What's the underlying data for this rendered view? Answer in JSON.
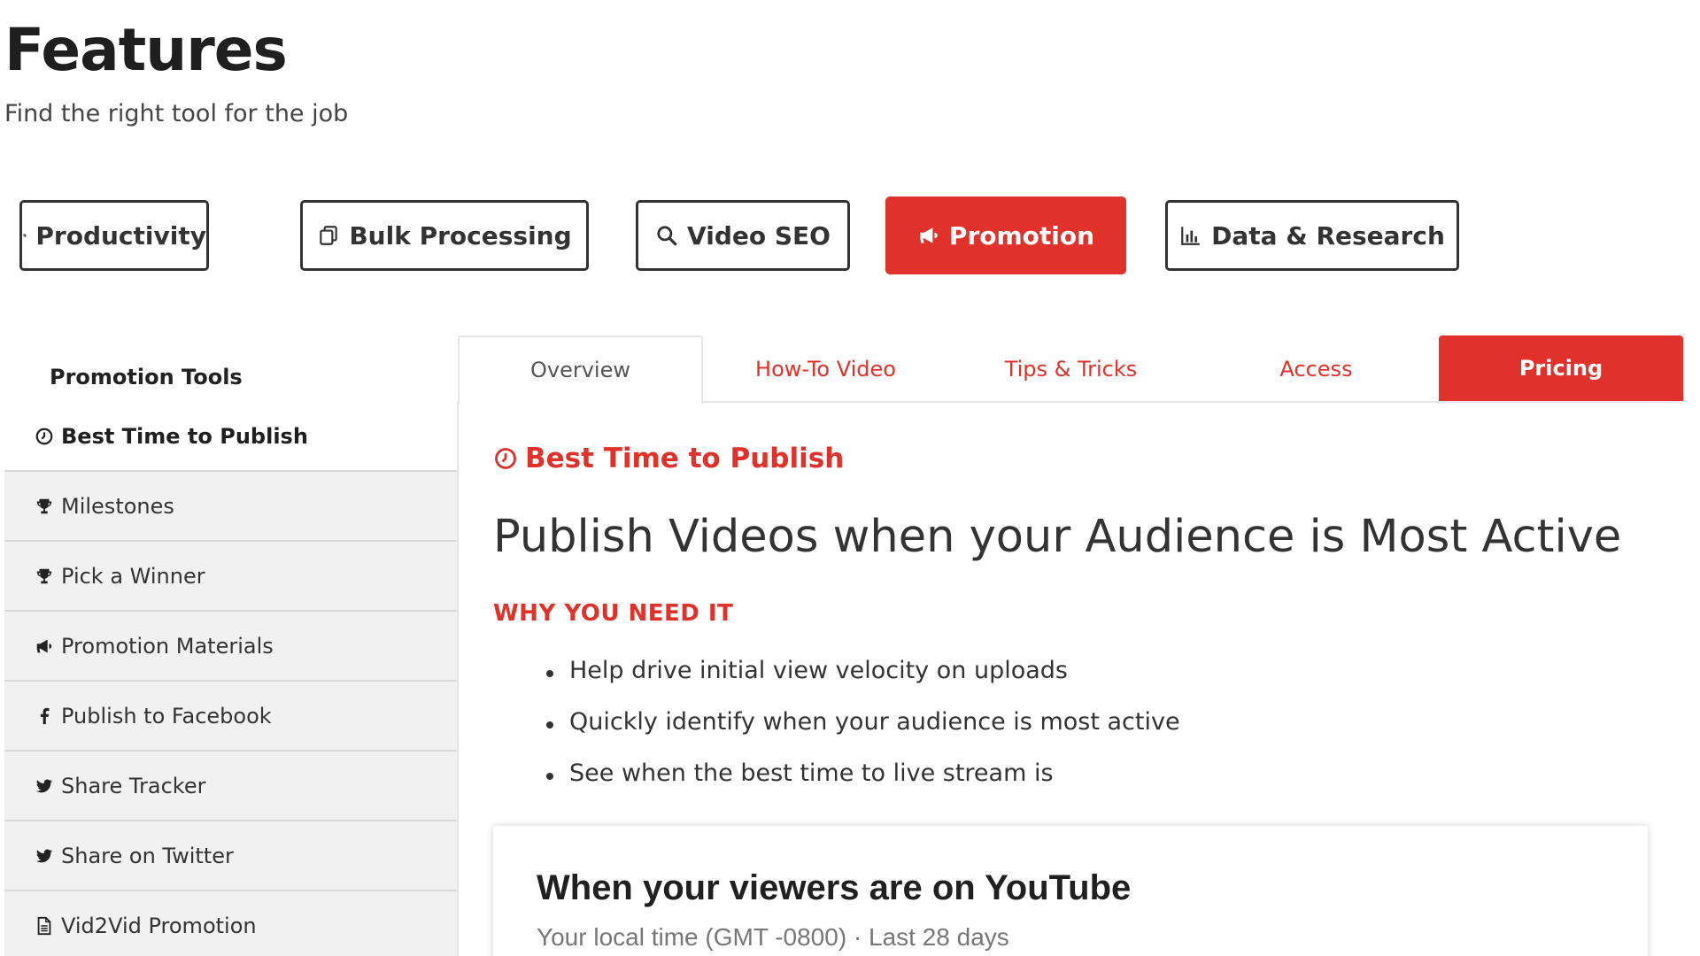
{
  "header": {
    "title": "Features",
    "subtitle": "Find the right tool for the job"
  },
  "categories": [
    {
      "label": "Productivity",
      "icon": "gear-icon"
    },
    {
      "label": "Bulk Processing",
      "icon": "copy-icon"
    },
    {
      "label": "Video SEO",
      "icon": "search-icon"
    },
    {
      "label": "Promotion",
      "icon": "megaphone-icon",
      "active": true
    },
    {
      "label": "Data & Research",
      "icon": "bar-chart-icon"
    }
  ],
  "sidebar": {
    "heading": "Promotion Tools",
    "items": [
      {
        "label": "Best Time to Publish",
        "icon": "clock-icon",
        "active": true
      },
      {
        "label": "Milestones",
        "icon": "trophy-icon"
      },
      {
        "label": "Pick a Winner",
        "icon": "trophy-icon"
      },
      {
        "label": "Promotion Materials",
        "icon": "megaphone-icon"
      },
      {
        "label": "Publish to Facebook",
        "icon": "facebook-icon"
      },
      {
        "label": "Share Tracker",
        "icon": "twitter-icon"
      },
      {
        "label": "Share on Twitter",
        "icon": "twitter-icon"
      },
      {
        "label": "Vid2Vid Promotion",
        "icon": "document-icon"
      }
    ]
  },
  "tabs": [
    {
      "label": "Overview",
      "active": true
    },
    {
      "label": "How-To Video"
    },
    {
      "label": "Tips & Tricks"
    },
    {
      "label": "Access"
    },
    {
      "label": "Pricing"
    }
  ],
  "content": {
    "section_title": "Best Time to Publish",
    "headline": "Publish Videos when your Audience is Most Active",
    "why_heading": "WHY YOU NEED IT",
    "benefits": [
      "Help drive initial view velocity on uploads",
      "Quickly identify when your audience is most active",
      "See when the best time to live stream is"
    ],
    "card": {
      "title": "When your viewers are on YouTube",
      "subtitle": "Your local time (GMT -0800) · Last 28 days"
    }
  },
  "colors": {
    "accent": "#e0322b",
    "border": "#333333",
    "sidebar_bg": "#f1f1f1"
  }
}
